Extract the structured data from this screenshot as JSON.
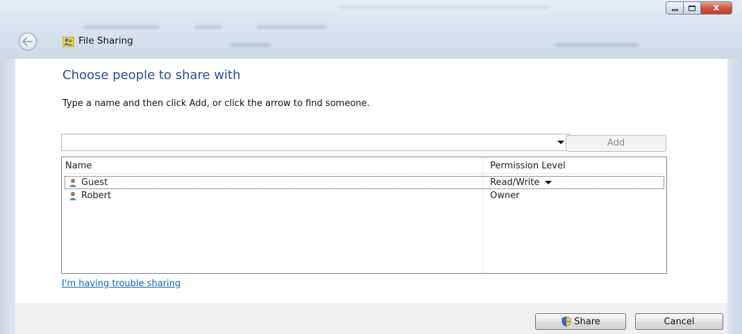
{
  "window": {
    "title": "File Sharing",
    "close_label": "x"
  },
  "dialog": {
    "heading": "Choose people to share with",
    "instructions": "Type a name and then click Add, or click the arrow to find someone.",
    "name_input": {
      "value": "",
      "placeholder": ""
    },
    "add_label": "Add",
    "columns": {
      "name": "Name",
      "permission": "Permission Level"
    },
    "rows": [
      {
        "name": "Guest",
        "permission": "Read/Write"
      },
      {
        "name": "Robert",
        "permission": "Owner"
      }
    ],
    "trouble_link": "I'm having trouble sharing"
  },
  "footer": {
    "share_label": "Share",
    "cancel_label": "Cancel"
  },
  "icons": {
    "back": "back-arrow-icon",
    "title": "people-sharing-icon",
    "user": "user-icon",
    "shield": "uac-shield-icon"
  },
  "colors": {
    "heading": "#1e4fa0",
    "link": "#0a66c2",
    "close_button": "#c23b22"
  }
}
